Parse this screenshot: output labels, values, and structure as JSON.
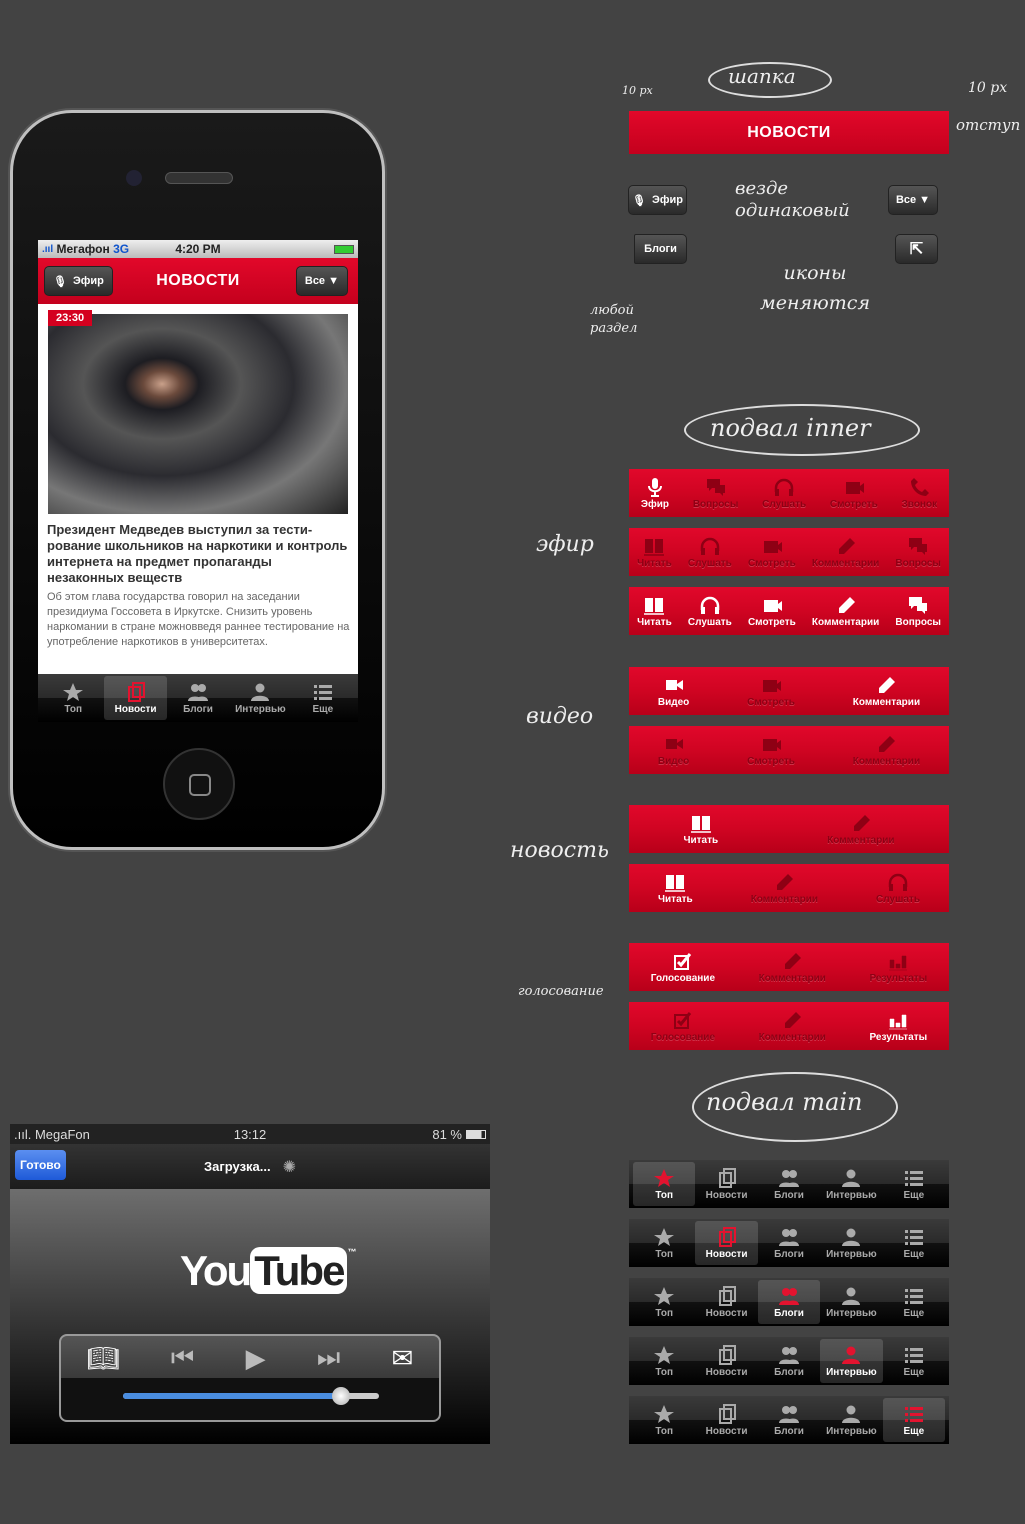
{
  "colors": {
    "brand_red": "#d4001f",
    "background": "#434343",
    "ios_blue": "#2f6fe0"
  },
  "phone": {
    "status": {
      "carrier": "Мегафон",
      "network": "3G",
      "time": "4:20 PM"
    },
    "header": {
      "title": "НОВОСТИ",
      "left_button": "Эфир",
      "right_button": "Все ▼"
    },
    "article": {
      "time": "23:30",
      "title": "Президент Медведев выступил за тести­рование школьников на наркотики и контроль интернета на предмет пропа­ганды незаконных веществ",
      "body": "Об этом глава государства говорил на заседании президиума Госсовета в Иркутске. Снизить уровень наркомании в стране можновведя раннее тестирование на употребление наркотиков в университетах."
    },
    "tabs": [
      {
        "label": "Топ",
        "icon": "star"
      },
      {
        "label": "Новости",
        "icon": "docs",
        "active": true
      },
      {
        "label": "Блоги",
        "icon": "people"
      },
      {
        "label": "Интервью",
        "icon": "person"
      },
      {
        "label": "Еще",
        "icon": "list"
      }
    ]
  },
  "header_spec": {
    "title": "НОВОСТИ",
    "buttons": {
      "efir": "Эфир",
      "all": "Все ▼",
      "blogs": "Блоги"
    }
  },
  "notes": {
    "shapka": "шапка",
    "px_left": "10 px",
    "px_right": "10 px",
    "otstup": "отступ",
    "same": "везде одинаковый",
    "any_section": "любой раздел",
    "icons_change": "иконы меняются",
    "footer_inner": "подвал inner",
    "efir": "эфир",
    "video": "видео",
    "news": "новость",
    "voting": "голосование",
    "footer_main": "подвал main"
  },
  "toolbars": [
    {
      "items": [
        {
          "label": "Эфир",
          "icon": "mic",
          "active": true
        },
        {
          "label": "Вопросы",
          "icon": "chat"
        },
        {
          "label": "Слушать",
          "icon": "headphones"
        },
        {
          "label": "Смотреть",
          "icon": "camera"
        },
        {
          "label": "Звонок",
          "icon": "phone"
        }
      ]
    },
    {
      "items": [
        {
          "label": "Читать",
          "icon": "book"
        },
        {
          "label": "Слушать",
          "icon": "headphones"
        },
        {
          "label": "Смотреть",
          "icon": "camera"
        },
        {
          "label": "Комментарии",
          "icon": "pencil"
        },
        {
          "label": "Вопросы",
          "icon": "chat"
        }
      ]
    },
    {
      "items": [
        {
          "label": "Читать",
          "icon": "book",
          "active": true
        },
        {
          "label": "Слушать",
          "icon": "headphones",
          "active": true
        },
        {
          "label": "Смотреть",
          "icon": "camera",
          "active": true
        },
        {
          "label": "Комментарии",
          "icon": "pencil",
          "active": true
        },
        {
          "label": "Вопросы",
          "icon": "chat",
          "active": true
        }
      ]
    },
    {
      "items": [
        {
          "label": "Видео",
          "icon": "video",
          "active": true
        },
        {
          "label": "Смотреть",
          "icon": "camera"
        },
        {
          "label": "Комментарии",
          "icon": "pencil",
          "active": true
        }
      ]
    },
    {
      "items": [
        {
          "label": "Видео",
          "icon": "video"
        },
        {
          "label": "Смотреть",
          "icon": "camera"
        },
        {
          "label": "Комментарии",
          "icon": "pencil"
        }
      ]
    },
    {
      "items": [
        {
          "label": "Читать",
          "icon": "book",
          "active": true
        },
        {
          "label": "Комментарии",
          "icon": "pencil"
        }
      ]
    },
    {
      "items": [
        {
          "label": "Читать",
          "icon": "book",
          "active": true
        },
        {
          "label": "Комментарии",
          "icon": "pencil"
        },
        {
          "label": "Слушать",
          "icon": "headphones"
        }
      ]
    },
    {
      "items": [
        {
          "label": "Голосование",
          "icon": "check",
          "active": true
        },
        {
          "label": "Комментарии",
          "icon": "pencil"
        },
        {
          "label": "Результаты",
          "icon": "bars"
        }
      ]
    },
    {
      "items": [
        {
          "label": "Голосование",
          "icon": "check"
        },
        {
          "label": "Комментарии",
          "icon": "pencil"
        },
        {
          "label": "Результаты",
          "icon": "bars",
          "active": true
        }
      ]
    }
  ],
  "main_tabbars": [
    0,
    1,
    2,
    3,
    4
  ],
  "youtube": {
    "status": {
      "carrier": "MegaFon",
      "time": "13:12",
      "battery": "81 %"
    },
    "done_button": "Готово",
    "loading": "Загрузка...",
    "logo": "YouTube™",
    "progress": 0.85
  }
}
